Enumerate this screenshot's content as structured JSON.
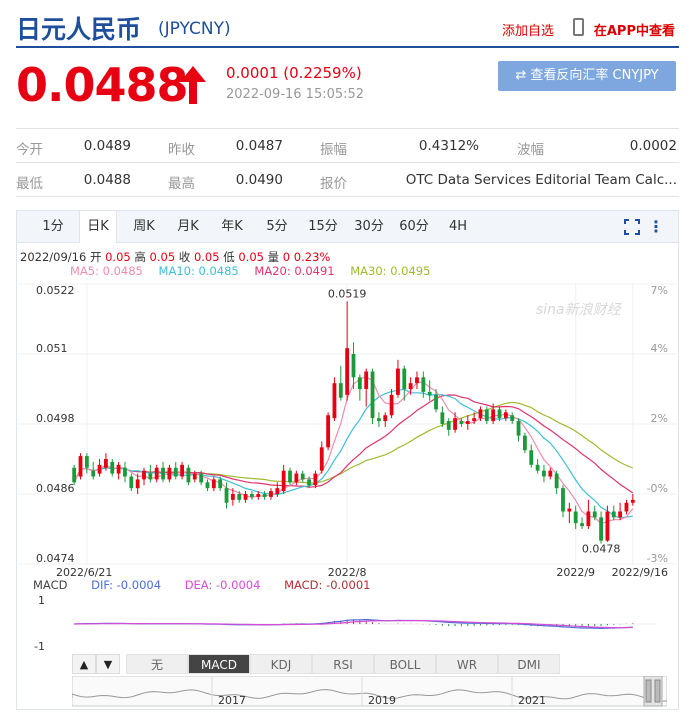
{
  "header": {
    "name": "日元人民币",
    "code": "(JPYCNY)",
    "watch_label": "添加自选",
    "app_label": "在APP中查看"
  },
  "quote": {
    "price": "0.0488",
    "change": "0.0001 (0.2259%)",
    "timestamp": "2022-09-16 15:05:52",
    "reverse_button": "⇄ 查看反向汇率 CNYJPY"
  },
  "stats": [
    [
      {
        "label": "今开",
        "value": "0.0489"
      },
      {
        "label": "昨收",
        "value": "0.0487"
      },
      {
        "label": "振幅",
        "value": "0.4312%"
      },
      {
        "label": "波幅",
        "value": "0.0002"
      }
    ],
    [
      {
        "label": "最低",
        "value": "0.0488"
      },
      {
        "label": "最高",
        "value": "0.0490"
      },
      {
        "label": "报价",
        "value": "OTC Data Services Editorial Team Calc..."
      },
      {
        "label": "",
        "value": ""
      }
    ]
  ],
  "period_tabs": [
    "1分",
    "日K",
    "周K",
    "月K",
    "年K",
    "5分",
    "15分",
    "30分",
    "60分",
    "4H"
  ],
  "active_period": 1,
  "ohlc_line": {
    "date": "2022/09/16",
    "open_label": "开",
    "open": "0.05",
    "high_label": "高",
    "high": "0.05",
    "close_label": "收",
    "close": "0.05",
    "low_label": "低",
    "low": "0.05",
    "vol_label": "量",
    "vol": "0",
    "pct": "0.23%"
  },
  "ma_line": {
    "ma5": "MA5: 0.0485",
    "ma10": "MA10: 0.0485",
    "ma20": "MA20: 0.0491",
    "ma30": "MA30: 0.0495"
  },
  "macd_line": {
    "label": "MACD",
    "dif": "DIF: -0.0004",
    "dea": "DEA: -0.0004",
    "macd": "MACD: -0.0001"
  },
  "indicator_tabs": [
    "无",
    "MACD",
    "KDJ",
    "RSI",
    "BOLL",
    "WR",
    "DMI"
  ],
  "active_indicator": 1,
  "nav_buttons": [
    "▲",
    "▼"
  ],
  "navigator_years": [
    "2017",
    "2019",
    "2021"
  ],
  "watermark": "sina新浪财经",
  "colors": {
    "up": "#e60012",
    "down": "#1a9a3a",
    "ma5": "#f08cb0",
    "ma10": "#3fbfd6",
    "ma20": "#e0336e",
    "ma30": "#9fbb2f",
    "dif": "#4a6fd6",
    "dea": "#d84ad8",
    "brand": "#1f4e9c"
  },
  "chart_data": {
    "type": "candlestick",
    "y_left_ticks": [
      "0.0522",
      "0.051",
      "0.0498",
      "0.0486",
      "0.0474"
    ],
    "y_right_ticks": [
      "7%",
      "4%",
      "2%",
      "-0%",
      "-3%"
    ],
    "x_ticks": [
      "2022/6/21",
      "2022/8",
      "2022/9",
      "2022/9/16"
    ],
    "ylim": [
      0.0474,
      0.0522
    ],
    "annotations": [
      {
        "label": "0.0519",
        "value": 0.0519
      },
      {
        "label": "0.0478",
        "value": 0.0478
      }
    ],
    "candles": [
      [
        0.04905,
        0.0488,
        0.0491,
        0.04875
      ],
      [
        0.0489,
        0.04925,
        0.0493,
        0.04885
      ],
      [
        0.04925,
        0.04905,
        0.0493,
        0.04895
      ],
      [
        0.049,
        0.0489,
        0.04915,
        0.04885
      ],
      [
        0.04895,
        0.0491,
        0.0492,
        0.0489
      ],
      [
        0.04905,
        0.0492,
        0.0493,
        0.049
      ],
      [
        0.04915,
        0.04895,
        0.0492,
        0.0489
      ],
      [
        0.04895,
        0.0491,
        0.04915,
        0.04885
      ],
      [
        0.04905,
        0.0489,
        0.04915,
        0.0488
      ],
      [
        0.0489,
        0.0487,
        0.04895,
        0.04865
      ],
      [
        0.0487,
        0.04885,
        0.04895,
        0.0486
      ],
      [
        0.04885,
        0.049,
        0.04905,
        0.04875
      ],
      [
        0.04895,
        0.04885,
        0.0491,
        0.0488
      ],
      [
        0.04885,
        0.04905,
        0.0491,
        0.0488
      ],
      [
        0.04905,
        0.04885,
        0.04915,
        0.0488
      ],
      [
        0.04885,
        0.04905,
        0.0491,
        0.0488
      ],
      [
        0.04905,
        0.0489,
        0.04915,
        0.04885
      ],
      [
        0.0489,
        0.0491,
        0.04915,
        0.04885
      ],
      [
        0.04905,
        0.0488,
        0.0491,
        0.04875
      ],
      [
        0.04885,
        0.04895,
        0.049,
        0.0488
      ],
      [
        0.04895,
        0.0488,
        0.049,
        0.04875
      ],
      [
        0.0488,
        0.0487,
        0.04885,
        0.04865
      ],
      [
        0.0487,
        0.04885,
        0.0489,
        0.04865
      ],
      [
        0.04885,
        0.0487,
        0.0489,
        0.04865
      ],
      [
        0.0487,
        0.04845,
        0.0488,
        0.04835
      ],
      [
        0.0485,
        0.0486,
        0.0487,
        0.0484
      ],
      [
        0.0486,
        0.0485,
        0.04865,
        0.04845
      ],
      [
        0.0485,
        0.0486,
        0.04865,
        0.04845
      ],
      [
        0.0486,
        0.04855,
        0.04865,
        0.0485
      ],
      [
        0.04855,
        0.0486,
        0.04865,
        0.0485
      ],
      [
        0.0486,
        0.04855,
        0.04865,
        0.0485
      ],
      [
        0.04855,
        0.04865,
        0.0487,
        0.0485
      ],
      [
        0.0486,
        0.0487,
        0.0488,
        0.04855
      ],
      [
        0.04865,
        0.049,
        0.0491,
        0.0486
      ],
      [
        0.049,
        0.0488,
        0.04905,
        0.04875
      ],
      [
        0.0488,
        0.04895,
        0.049,
        0.04875
      ],
      [
        0.04895,
        0.04885,
        0.049,
        0.0488
      ],
      [
        0.04885,
        0.04875,
        0.0489,
        0.0487
      ],
      [
        0.04875,
        0.04895,
        0.049,
        0.0487
      ],
      [
        0.049,
        0.0494,
        0.0495,
        0.04895
      ],
      [
        0.0494,
        0.04995,
        0.05,
        0.04935
      ],
      [
        0.0499,
        0.0505,
        0.0506,
        0.04985
      ],
      [
        0.0505,
        0.05025,
        0.0508,
        0.0502
      ],
      [
        0.0503,
        0.0511,
        0.0519,
        0.0502
      ],
      [
        0.051,
        0.0506,
        0.0512,
        0.0504
      ],
      [
        0.0506,
        0.0504,
        0.05065,
        0.0502
      ],
      [
        0.0504,
        0.0507,
        0.05075,
        0.0501
      ],
      [
        0.0507,
        0.0499,
        0.05075,
        0.0498
      ],
      [
        0.0499,
        0.04985,
        0.05,
        0.04975
      ],
      [
        0.04985,
        0.04995,
        0.05,
        0.04975
      ],
      [
        0.04995,
        0.0503,
        0.0504,
        0.0499
      ],
      [
        0.0503,
        0.05075,
        0.0509,
        0.05025
      ],
      [
        0.05075,
        0.0504,
        0.0508,
        0.0502
      ],
      [
        0.0504,
        0.0505,
        0.0506,
        0.0503
      ],
      [
        0.0505,
        0.0506,
        0.0507,
        0.0504
      ],
      [
        0.0506,
        0.05035,
        0.0507,
        0.05025
      ],
      [
        0.05035,
        0.0503,
        0.05055,
        0.0502
      ],
      [
        0.0503,
        0.05005,
        0.0504,
        0.05
      ],
      [
        0.05,
        0.0498,
        0.0501,
        0.04975
      ],
      [
        0.04985,
        0.0497,
        0.0499,
        0.0496
      ],
      [
        0.0497,
        0.0499,
        0.05,
        0.04965
      ],
      [
        0.04985,
        0.0498,
        0.0499,
        0.04975
      ],
      [
        0.0498,
        0.04985,
        0.04995,
        0.0497
      ],
      [
        0.04985,
        0.0499,
        0.05,
        0.0498
      ],
      [
        0.0499,
        0.05005,
        0.0501,
        0.04985
      ],
      [
        0.05005,
        0.04985,
        0.0501,
        0.0498
      ],
      [
        0.04985,
        0.05005,
        0.05015,
        0.0498
      ],
      [
        0.05005,
        0.0499,
        0.0501,
        0.04985
      ],
      [
        0.0499,
        0.05,
        0.05005,
        0.04985
      ],
      [
        0.04995,
        0.04985,
        0.05,
        0.0498
      ],
      [
        0.04985,
        0.0496,
        0.0499,
        0.0495
      ],
      [
        0.0496,
        0.04935,
        0.04965,
        0.0493
      ],
      [
        0.04935,
        0.0491,
        0.04945,
        0.04905
      ],
      [
        0.0491,
        0.049,
        0.0492,
        0.04895
      ],
      [
        0.049,
        0.0489,
        0.0491,
        0.0488
      ],
      [
        0.0489,
        0.049,
        0.04905,
        0.04885
      ],
      [
        0.04895,
        0.0487,
        0.049,
        0.0486
      ],
      [
        0.0487,
        0.0483,
        0.04875,
        0.0482
      ],
      [
        0.0483,
        0.04835,
        0.04845,
        0.0481
      ],
      [
        0.0483,
        0.0481,
        0.0484,
        0.048
      ],
      [
        0.0481,
        0.04805,
        0.0482,
        0.048
      ],
      [
        0.04805,
        0.0483,
        0.0485,
        0.048
      ],
      [
        0.0483,
        0.0482,
        0.0484,
        0.04815
      ],
      [
        0.0482,
        0.0478,
        0.0483,
        0.04775
      ],
      [
        0.0478,
        0.0483,
        0.0484,
        0.04778
      ],
      [
        0.0483,
        0.0482,
        0.0484,
        0.04815
      ],
      [
        0.0482,
        0.0483,
        0.04845,
        0.04815
      ],
      [
        0.0483,
        0.04845,
        0.0485,
        0.04825
      ],
      [
        0.04845,
        0.0485,
        0.0486,
        0.0484
      ]
    ]
  }
}
